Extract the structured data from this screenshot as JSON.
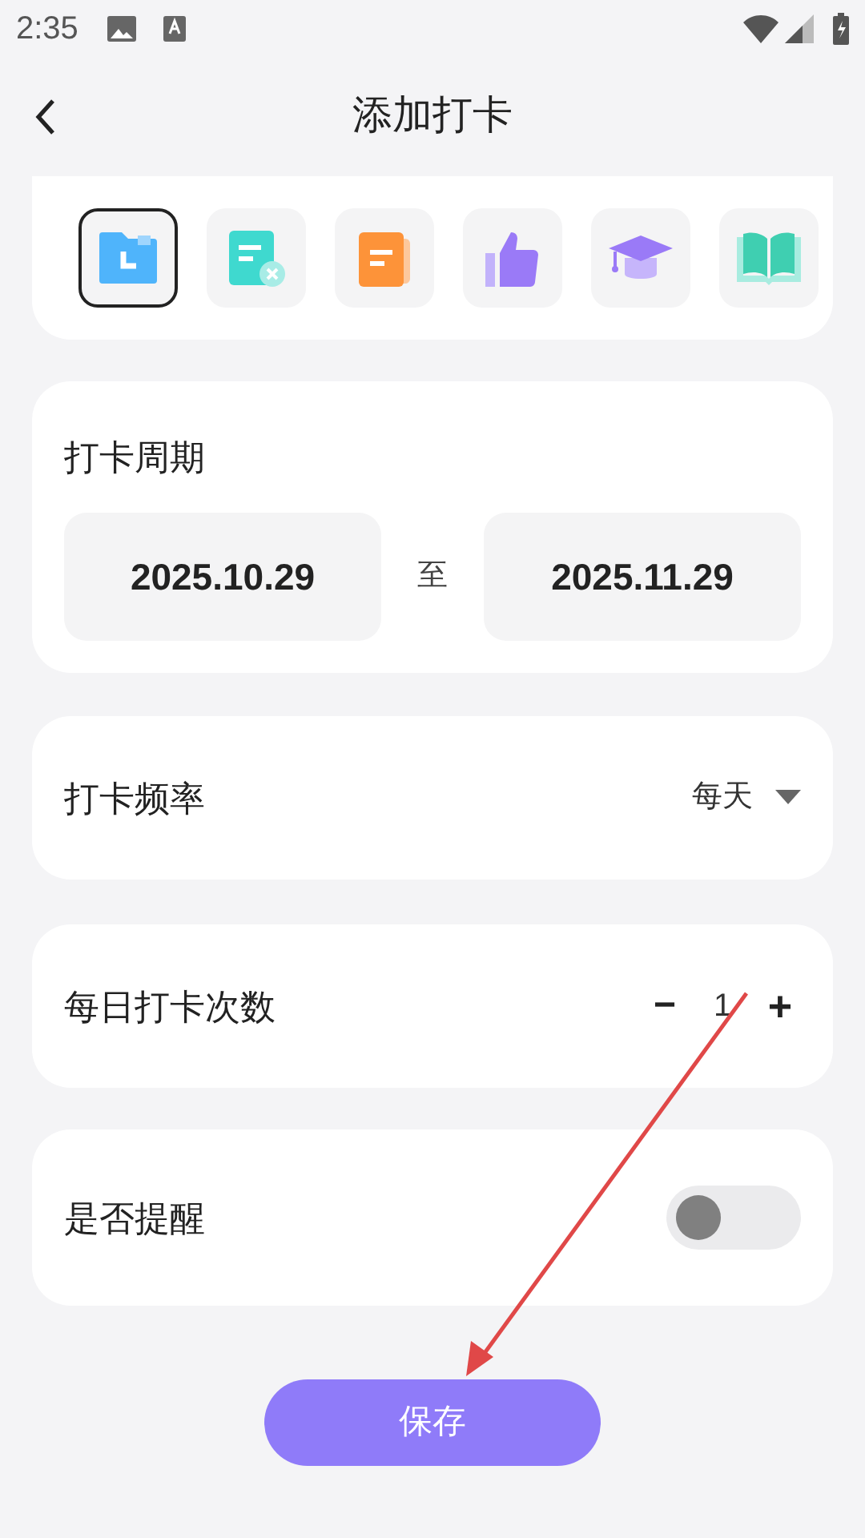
{
  "status_bar": {
    "time": "2:35"
  },
  "header": {
    "title": "添加打卡"
  },
  "icon_picker": [
    {
      "kind": "folder",
      "selected": true
    },
    {
      "kind": "note",
      "selected": false
    },
    {
      "kind": "doc",
      "selected": false
    },
    {
      "kind": "thumb",
      "selected": false
    },
    {
      "kind": "cap",
      "selected": false
    },
    {
      "kind": "book",
      "selected": false
    }
  ],
  "period": {
    "label": "打卡周期",
    "start": "2025.10.29",
    "separator": "至",
    "end": "2025.11.29"
  },
  "frequency": {
    "label": "打卡频率",
    "value": "每天"
  },
  "daily_count": {
    "label": "每日打卡次数",
    "minus": "−",
    "value": "1",
    "plus": "+"
  },
  "reminder": {
    "label": "是否提醒",
    "on": false
  },
  "save_button": "保存",
  "annotation": {
    "kind": "arrow"
  }
}
